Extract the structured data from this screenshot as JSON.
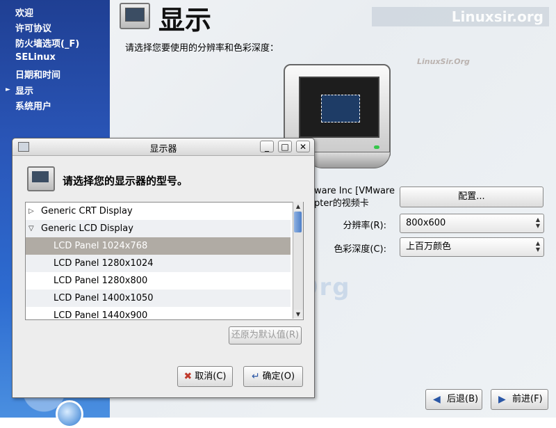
{
  "watermarks": {
    "main": "LinuxSir.Org",
    "banner": "Linuxsir.org",
    "small": "LinuxSir.Org"
  },
  "sidebar": {
    "items": [
      {
        "label": "欢迎"
      },
      {
        "label": "许可协议"
      },
      {
        "label": "防火墙选项(_F)"
      },
      {
        "label": "SELinux"
      },
      {
        "label": "日期和时间"
      },
      {
        "label": "显示",
        "current": true
      },
      {
        "label": "系统用户"
      }
    ]
  },
  "header": {
    "title": "显示",
    "subtitle": "请选择您要使用的分辨率和色彩深度："
  },
  "display_panel": {
    "card_text": "ware Inc [VMware\npter的视频卡",
    "configure_label": "配置...",
    "resolution_label": "分辨率(R):",
    "resolution_value": "800x600",
    "depth_label": "色彩深度(C):",
    "depth_value": "上百万颜色"
  },
  "nav": {
    "back_label": "后退(B)",
    "forward_label": "前进(F)"
  },
  "dialog": {
    "title": "显示器",
    "prompt": "请选择您的显示器的型号。",
    "rows": [
      {
        "label": "Generic CRT Display",
        "level": 0,
        "expander": "collapsed"
      },
      {
        "label": "Generic LCD Display",
        "level": 0,
        "expander": "expanded"
      },
      {
        "label": "LCD Panel 1024x768",
        "level": 1,
        "selected": true
      },
      {
        "label": "LCD Panel 1280x1024",
        "level": 1
      },
      {
        "label": "LCD Panel 1280x800",
        "level": 1
      },
      {
        "label": "LCD Panel 1400x1050",
        "level": 1
      },
      {
        "label": "LCD Panel 1440x900",
        "level": 1
      }
    ],
    "revert_label": "还原为默认值(R)",
    "cancel_label": "取消(C)",
    "ok_label": "确定(O)"
  }
}
